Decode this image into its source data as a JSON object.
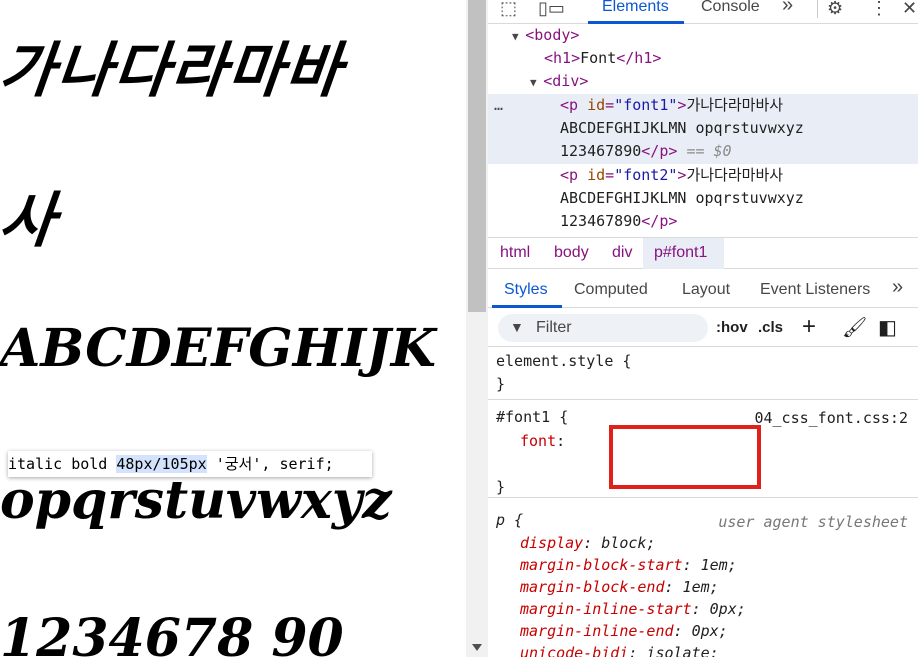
{
  "preview": {
    "lines": [
      "가나다라마바",
      "사",
      "ABCDEFGHIJK",
      "opqrstuvwxyz",
      "1234678 90"
    ]
  },
  "devtools": {
    "tabs": {
      "elements": "Elements",
      "console": "Console",
      "more": "»"
    },
    "dom": {
      "body_open": "<body>",
      "h1_open": "<h1>",
      "h1_text": "Font",
      "h1_close": "</h1>",
      "div_open": "<div>",
      "p1_tag": "<p",
      "p1_attr": "id",
      "p1_val": "\"font1\"",
      "p1_text_a": "가나다라마바사",
      "p1_text_b": "ABCDEFGHIJKLMN opqrstuvwxyz",
      "p1_text_c": "123467890",
      "p_close": "</p>",
      "eq0": "== $0",
      "p2_val": "\"font2\"",
      "p2_text_a": "가나다라마바사",
      "p2_text_b": "ABCDEFGHIJKLMN opqrstuvwxyz",
      "p2_text_c": "123467890"
    },
    "breadcrumb": [
      "html",
      "body",
      "div",
      "p#font1"
    ],
    "style_tabs": [
      "Styles",
      "Computed",
      "Layout",
      "Event Listeners",
      "»"
    ],
    "filter": {
      "placeholder": "Filter",
      "hov": ":hov",
      "cls": ".cls",
      "plus": "+"
    },
    "rules": {
      "element_style": "element.style {",
      "close": "}",
      "font1_selector": "#font1 {",
      "font1_source": "04_css_font.css:2",
      "font1_prop": "font",
      "font1_value_a": "italic bold ",
      "font1_value_b": "48px/",
      "font1_value_c": "105px",
      "font1_value_d": " '궁서', serif;",
      "p_selector": "p {",
      "p_source": "user agent stylesheet",
      "p_props": [
        {
          "name": "display",
          "value": "block;"
        },
        {
          "name": "margin-block-start",
          "value": "1em;"
        },
        {
          "name": "margin-block-end",
          "value": "1em;"
        },
        {
          "name": "margin-inline-start",
          "value": "0px;"
        },
        {
          "name": "margin-inline-end",
          "value": "0px;"
        },
        {
          "name": "unicode-bidi",
          "value": "isolate;"
        }
      ]
    }
  },
  "colors": {
    "accent": "#0b57d0",
    "highlight_box": "#e0201a",
    "tag": "#881280",
    "prop": "#c80000"
  }
}
